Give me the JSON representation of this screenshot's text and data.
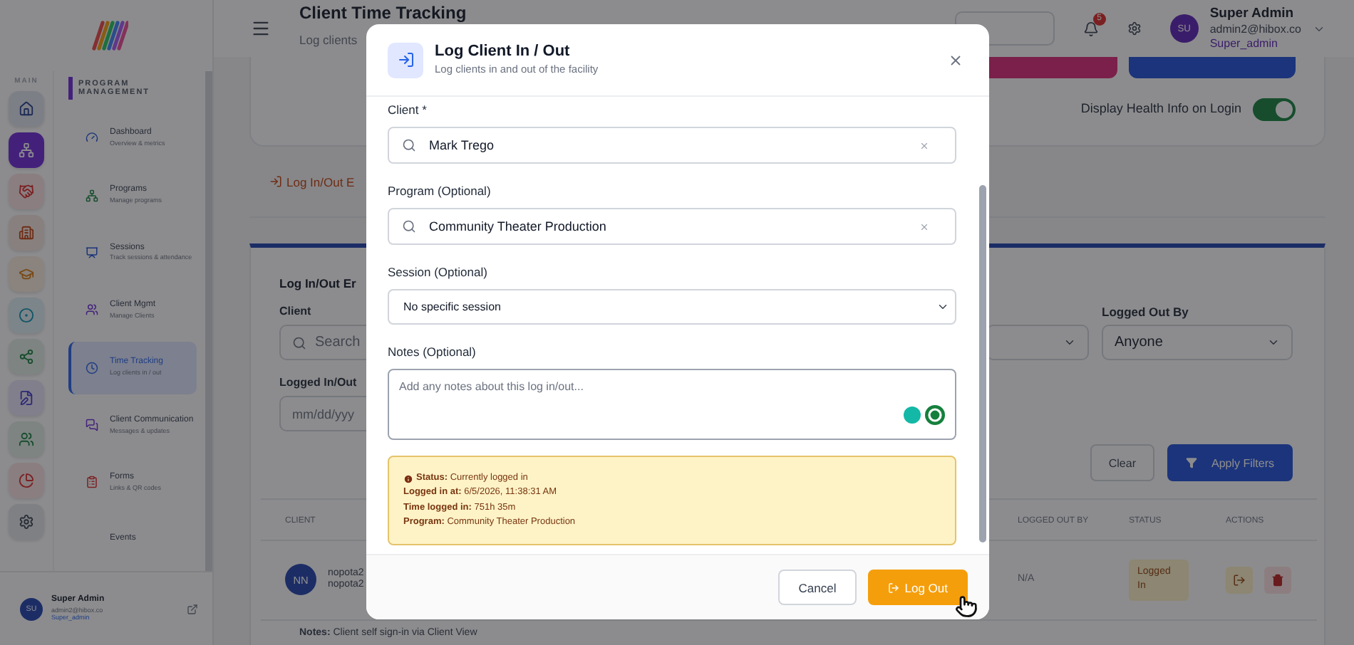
{
  "sidebar": {
    "section_label": "MAIN",
    "group_title": "PROGRAM MANAGEMENT",
    "rail": [
      {
        "selected": false
      },
      {
        "selected": true
      },
      {
        "selected": false
      },
      {
        "selected": false
      },
      {
        "selected": false
      },
      {
        "selected": false
      },
      {
        "selected": false
      },
      {
        "selected": false
      },
      {
        "selected": false
      },
      {
        "selected": false
      },
      {
        "selected": false
      }
    ],
    "nav": [
      {
        "title": "Dashboard",
        "subtitle": "Overview & metrics",
        "selected": false
      },
      {
        "title": "Programs",
        "subtitle": "Manage programs",
        "selected": false
      },
      {
        "title": "Sessions",
        "subtitle": "Track sessions & attendance",
        "selected": false
      },
      {
        "title": "Client Mgmt",
        "subtitle": "Manage Clients",
        "selected": false
      },
      {
        "title": "Time Tracking",
        "subtitle": "Log clients in / out",
        "selected": true
      },
      {
        "title": "Client Communication",
        "subtitle": "Messages & updates",
        "selected": false
      },
      {
        "title": "Forms",
        "subtitle": "Links & QR codes",
        "selected": false
      },
      {
        "title": "Events",
        "selected": false
      }
    ],
    "user": {
      "initials": "SU",
      "name": "Super Admin",
      "email": "admin2@hibox.co",
      "role": "Super_admin"
    }
  },
  "header": {
    "title": "Client Time Tracking",
    "subtitle": "Log clients",
    "notifications": "5",
    "user": {
      "initials": "SU",
      "name": "Super Admin",
      "email": "admin2@hibox.co",
      "role": "Super_admin"
    }
  },
  "settings_card": {
    "toggle_label": "Display Health Info on Login",
    "on": true
  },
  "tab": {
    "label": "Log In/Out E"
  },
  "filters": {
    "title": "Log In/Out Er",
    "client_label": "Client",
    "client_placeholder": "Search",
    "logged_out_by_label": "Logged Out By",
    "logged_out_by_value": "Anyone",
    "date_label": "Logged In/Out",
    "date_placeholder": "mm/dd/yyy",
    "clear": "Clear",
    "apply": "Apply Filters"
  },
  "table": {
    "columns": [
      "CLIENT",
      "LOGGED OUT BY",
      "STATUS",
      "ACTIONS"
    ],
    "rows": [
      {
        "initials": "NN",
        "name": "nopota2",
        "email": "nopota2",
        "logged_out_by": "N/A",
        "status": "Logged In"
      }
    ]
  },
  "note": "**Notes:** Client self sign-in via Client View",
  "modal": {
    "title": "Log Client In / Out",
    "subtitle": "Log clients in and out of the facility",
    "client_label": "Client *",
    "client_value": "Mark Trego",
    "program_label": "Program (Optional)",
    "program_value": "Community Theater Production",
    "session_label": "Session (Optional)",
    "session_value": "No specific session",
    "notes_label": "Notes (Optional)",
    "notes_placeholder": "Add any notes about this log in/out...",
    "status_lines": [
      "**Status:** Currently logged in",
      "**Logged in at:** 6/5/2026, 11:38:31 AM",
      "**Time logged in:** 751h 35m",
      "**Program:** Community Theater Production"
    ],
    "cancel": "Cancel",
    "submit": "Log Out"
  }
}
